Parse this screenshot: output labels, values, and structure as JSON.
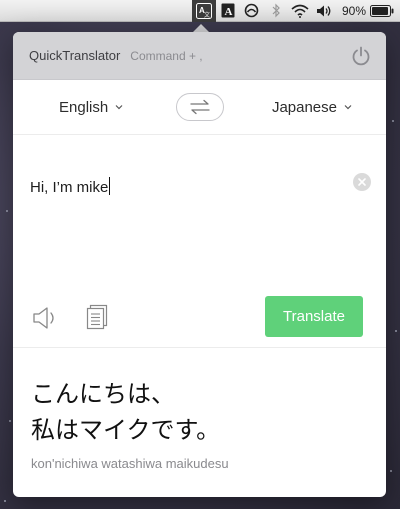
{
  "menubar": {
    "icons": [
      "translator-icon",
      "font-book-icon",
      "circle-arrow-icon",
      "bluetooth-icon",
      "wifi-icon",
      "volume-icon"
    ],
    "battery_percent": "90%"
  },
  "app": {
    "name": "QuickTranslator",
    "shortcut": "Command + ,"
  },
  "languages": {
    "source": "English",
    "target": "Japanese"
  },
  "input": {
    "text": "Hi, I’m mike"
  },
  "actions": {
    "translate_label": "Translate"
  },
  "output": {
    "line1": "こんにちは、",
    "line2": "私はマイクです。",
    "romanization": "kon'nichiwa watashiwa maikudesu"
  },
  "colors": {
    "translate_button": "#5fd17a",
    "titlebar": "#d3d3d6",
    "menubar_active": "#3c3c3c"
  }
}
